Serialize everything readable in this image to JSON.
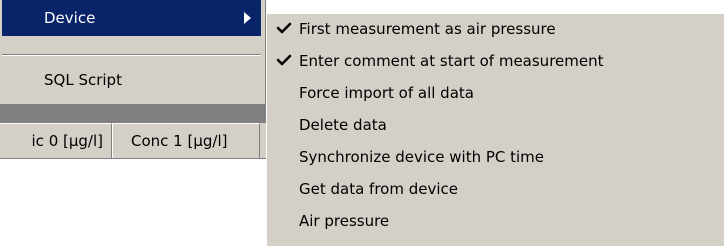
{
  "menu": {
    "items": [
      {
        "label": "Device",
        "highlighted": true,
        "has_submenu": true,
        "arrow_icon": "submenu-arrow-icon"
      },
      {
        "label": "SQL Script",
        "highlighted": false,
        "has_submenu": false
      }
    ]
  },
  "grid": {
    "columns": [
      {
        "label": "ic 0 [µg/l]"
      },
      {
        "label": "Conc 1 [µg/l]"
      }
    ]
  },
  "submenu": {
    "items": [
      {
        "label": "First measurement as air pressure",
        "checked": true
      },
      {
        "label": "Enter comment at start of measurement",
        "checked": true
      },
      {
        "label": "Force import of all data",
        "checked": false
      },
      {
        "label": "Delete data",
        "checked": false
      },
      {
        "label": "Synchronize device with PC time",
        "checked": false
      },
      {
        "label": "Get data from device",
        "checked": false
      },
      {
        "label": "Air pressure",
        "checked": false
      }
    ],
    "check_icon": "checkmark-icon"
  },
  "colors": {
    "menu_background": "#d4d0c8",
    "highlight": "#0a246a",
    "highlight_text": "#ffffff",
    "text": "#000000",
    "grid_bar": "#808080"
  }
}
